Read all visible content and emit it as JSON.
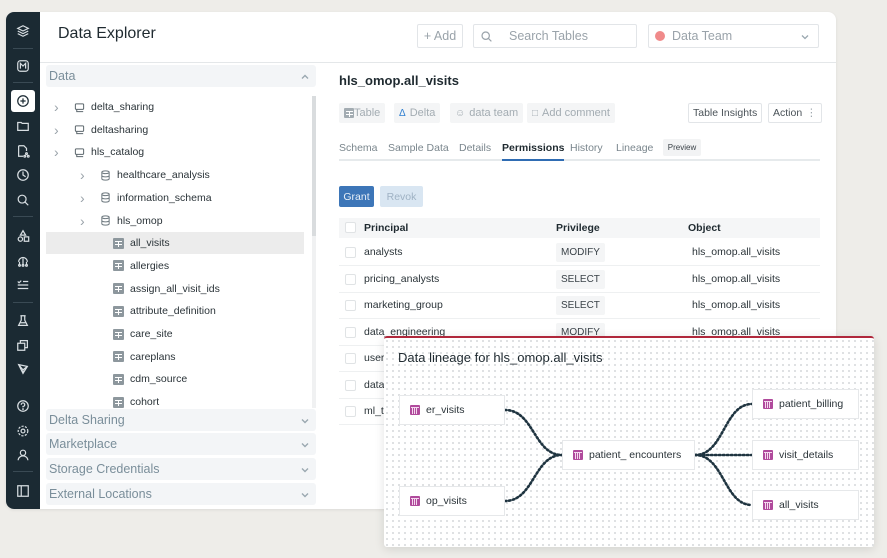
{
  "app": {
    "title": "Data Explorer",
    "add_label": "+ Add",
    "search_placeholder": "Search Tables",
    "workspace": "Data Team"
  },
  "rail": {
    "icons": [
      "logo-stack-icon",
      "m-badge-icon",
      "plus-circle-icon",
      "folder-icon",
      "file-share-icon",
      "clock-icon",
      "search-icon",
      "shapes-icon",
      "network-icon",
      "checklist-icon",
      "flask-icon",
      "copy-icon",
      "graph-icon",
      "help-icon",
      "settings-icon",
      "user-icon",
      "sidebar-toggle-icon"
    ],
    "active": "plus-circle-icon"
  },
  "explorer": {
    "data_section": "Data",
    "tree": [
      {
        "label": "delta_sharing",
        "level": 0,
        "type": "catalog",
        "expandable": true
      },
      {
        "label": "deltasharing",
        "level": 0,
        "type": "catalog",
        "expandable": true
      },
      {
        "label": "hls_catalog",
        "level": 0,
        "type": "catalog",
        "expandable": true
      },
      {
        "label": "healthcare_analysis",
        "level": 1,
        "type": "schema",
        "expandable": true
      },
      {
        "label": "information_schema",
        "level": 1,
        "type": "schema",
        "expandable": true
      },
      {
        "label": "hls_omop",
        "level": 1,
        "type": "schema",
        "expandable": true
      },
      {
        "label": "all_visits",
        "level": 2,
        "type": "table",
        "selected": true
      },
      {
        "label": "allergies",
        "level": 2,
        "type": "table"
      },
      {
        "label": "assign_all_visit_ids",
        "level": 2,
        "type": "table"
      },
      {
        "label": "attribute_definition",
        "level": 2,
        "type": "table"
      },
      {
        "label": "care_site",
        "level": 2,
        "type": "table"
      },
      {
        "label": "careplans",
        "level": 2,
        "type": "table"
      },
      {
        "label": "cdm_source",
        "level": 2,
        "type": "table"
      },
      {
        "label": "cohort",
        "level": 2,
        "type": "table"
      }
    ],
    "sections": [
      "Delta Sharing",
      "Marketplace",
      "Storage Credentials",
      "External Locations"
    ]
  },
  "detail": {
    "title": "hls_omop.all_visits",
    "chips": [
      {
        "icon": "table-icon",
        "label": "Table"
      },
      {
        "icon": "delta-icon",
        "label": "Delta"
      },
      {
        "icon": "user-icon",
        "label": "data team"
      },
      {
        "icon": "comment-icon",
        "label": "Add comment"
      }
    ],
    "insights_label": "Table Insights",
    "action_label": "Action",
    "tabs": [
      "Schema",
      "Sample Data",
      "Details",
      "Permissions",
      "History",
      "Lineage"
    ],
    "active_tab": "Permissions",
    "preview_badge": "Preview",
    "grant_label": "Grant",
    "revoke_label": "Revok",
    "columns": [
      "Principal",
      "Privilege",
      "Object"
    ],
    "rows": [
      {
        "principal": "analysts",
        "privilege": "MODIFY",
        "object": "hls_omop.all_visits"
      },
      {
        "principal": "pricing_analysts",
        "privilege": "SELECT",
        "object": "hls_omop.all_visits"
      },
      {
        "principal": "marketing_group",
        "privilege": "SELECT",
        "object": "hls_omop.all_visits"
      },
      {
        "principal": "data_engineering",
        "privilege": "MODIFY",
        "object": "hls_omop.all_visits"
      },
      {
        "principal": "user",
        "privilege": "",
        "object": ""
      },
      {
        "principal": "data",
        "privilege": "",
        "object": ""
      },
      {
        "principal": "ml_t",
        "privilege": "",
        "object": ""
      }
    ]
  },
  "lineage": {
    "title": "Data lineage for hls_omop.all_visits",
    "upstream": [
      "er_visits",
      "op_visits"
    ],
    "center": "patient_ encounters",
    "downstream": [
      "patient_billing",
      "visit_details",
      "all_visits"
    ]
  },
  "colors": {
    "rail_bg": "#1b2a33",
    "accent_blue": "#3d76b8",
    "lineage_border": "#b0283c",
    "table_icon_pink": "#b04a9c",
    "workspace_dot": "#f08a8a"
  }
}
